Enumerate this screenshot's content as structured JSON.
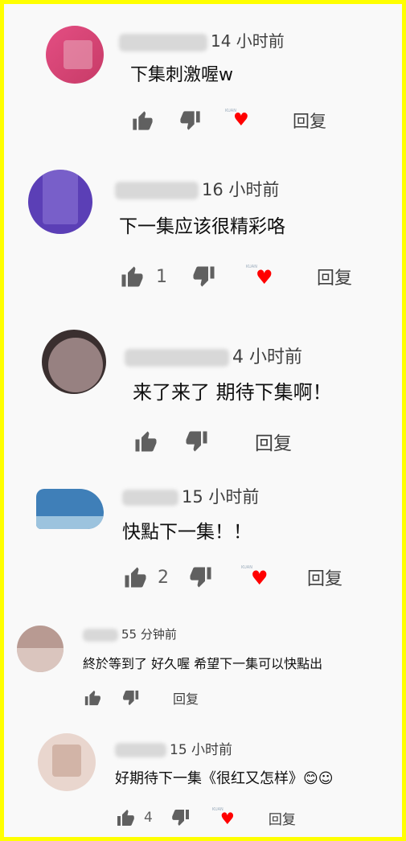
{
  "comments": [
    {
      "time": "14 小时前",
      "text": "下集刺激喔w",
      "likes": "",
      "reply": "回复",
      "hearted": true,
      "avatar_colors": [
        "#d64a78",
        "#e89bb0"
      ]
    },
    {
      "time": "16 小时前",
      "text": "下一集应该很精彩咯",
      "likes": "1",
      "reply": "回复",
      "hearted": true,
      "avatar_colors": [
        "#5b3fb6",
        "#8a74d6"
      ]
    },
    {
      "time": "4 小时前",
      "text": "来了来了 期待下集啊！",
      "likes": "",
      "reply": "回复",
      "hearted": false,
      "avatar_colors": [
        "#5a4a4a",
        "#b49b9b"
      ]
    },
    {
      "time": "15 小时前",
      "text": "快點下一集！！",
      "likes": "2",
      "reply": "回复",
      "hearted": true,
      "avatar_colors": [
        "#3f7fb8",
        "#9cc3de"
      ]
    },
    {
      "time": "55 分钟前",
      "text": "終於等到了 好久喔 希望下一集可以快點出",
      "likes": "",
      "reply": "回复",
      "hearted": false,
      "avatar_colors": [
        "#b89a92",
        "#e2cfc9"
      ]
    },
    {
      "time": "15 小时前",
      "text": "好期待下一集《很红又怎样》😊☺",
      "likes": "4",
      "reply": "回复",
      "hearted": true,
      "avatar_colors": [
        "#d9b9ac",
        "#f0dfd7"
      ]
    }
  ],
  "icons": {
    "like": "thumbs-up-icon",
    "dislike": "thumbs-down-icon",
    "heart": "creator-heart-icon"
  },
  "colors": {
    "border": "#ffff00",
    "heart": "#ff0000",
    "icon": "#606060"
  }
}
